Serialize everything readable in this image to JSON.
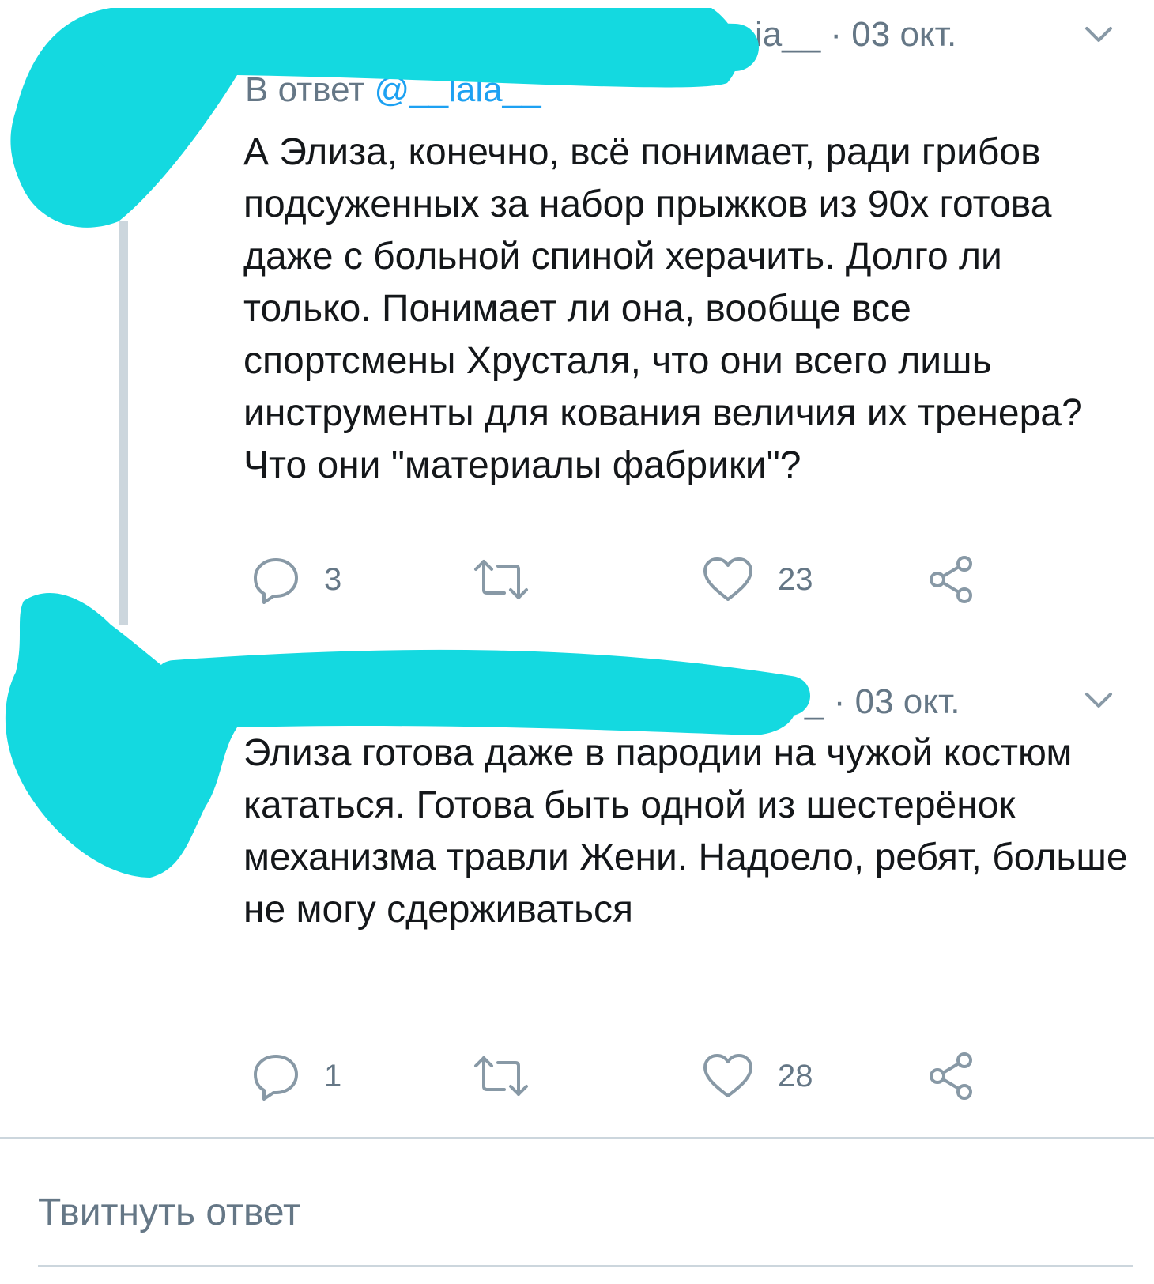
{
  "colors": {
    "redaction": "#14d9e0",
    "text": "#14171a",
    "secondary": "#657786",
    "thread_line": "#ccd6dd",
    "link": "#1da1f2"
  },
  "tweets": [
    {
      "handle_partial": "ia__",
      "date": "· 03 окт.",
      "reply_to_label": "В ответ",
      "reply_to_handle": "@__lala__",
      "text": "А Элиза, конечно, всё понимает, ради грибов подсуженных за набор прыжков из 90х готова даже с больной спиной херачить. Долго ли только. Понимает ли она, вообще все спортсмены Хрусталя, что они всего лишь инструменты для кования величия их тренера? Что они \"материалы фабрики\"?",
      "reply_count": "3",
      "like_count": "23",
      "icons": [
        "reply-icon",
        "retweet-icon",
        "like-icon",
        "share-icon",
        "chevron-down-icon"
      ]
    },
    {
      "handle_partial": "_",
      "date": "· 03 окт.",
      "text": "Элиза готова даже в пародии на чужой костюм кататься. Готова быть одной из шестерёнок механизма травли Жени. Надоело, ребят, больше не могу сдерживаться",
      "reply_count": "1",
      "like_count": "28",
      "icons": [
        "reply-icon",
        "retweet-icon",
        "like-icon",
        "share-icon",
        "chevron-down-icon"
      ]
    }
  ],
  "reply_box": {
    "placeholder": "Твитнуть ответ"
  }
}
